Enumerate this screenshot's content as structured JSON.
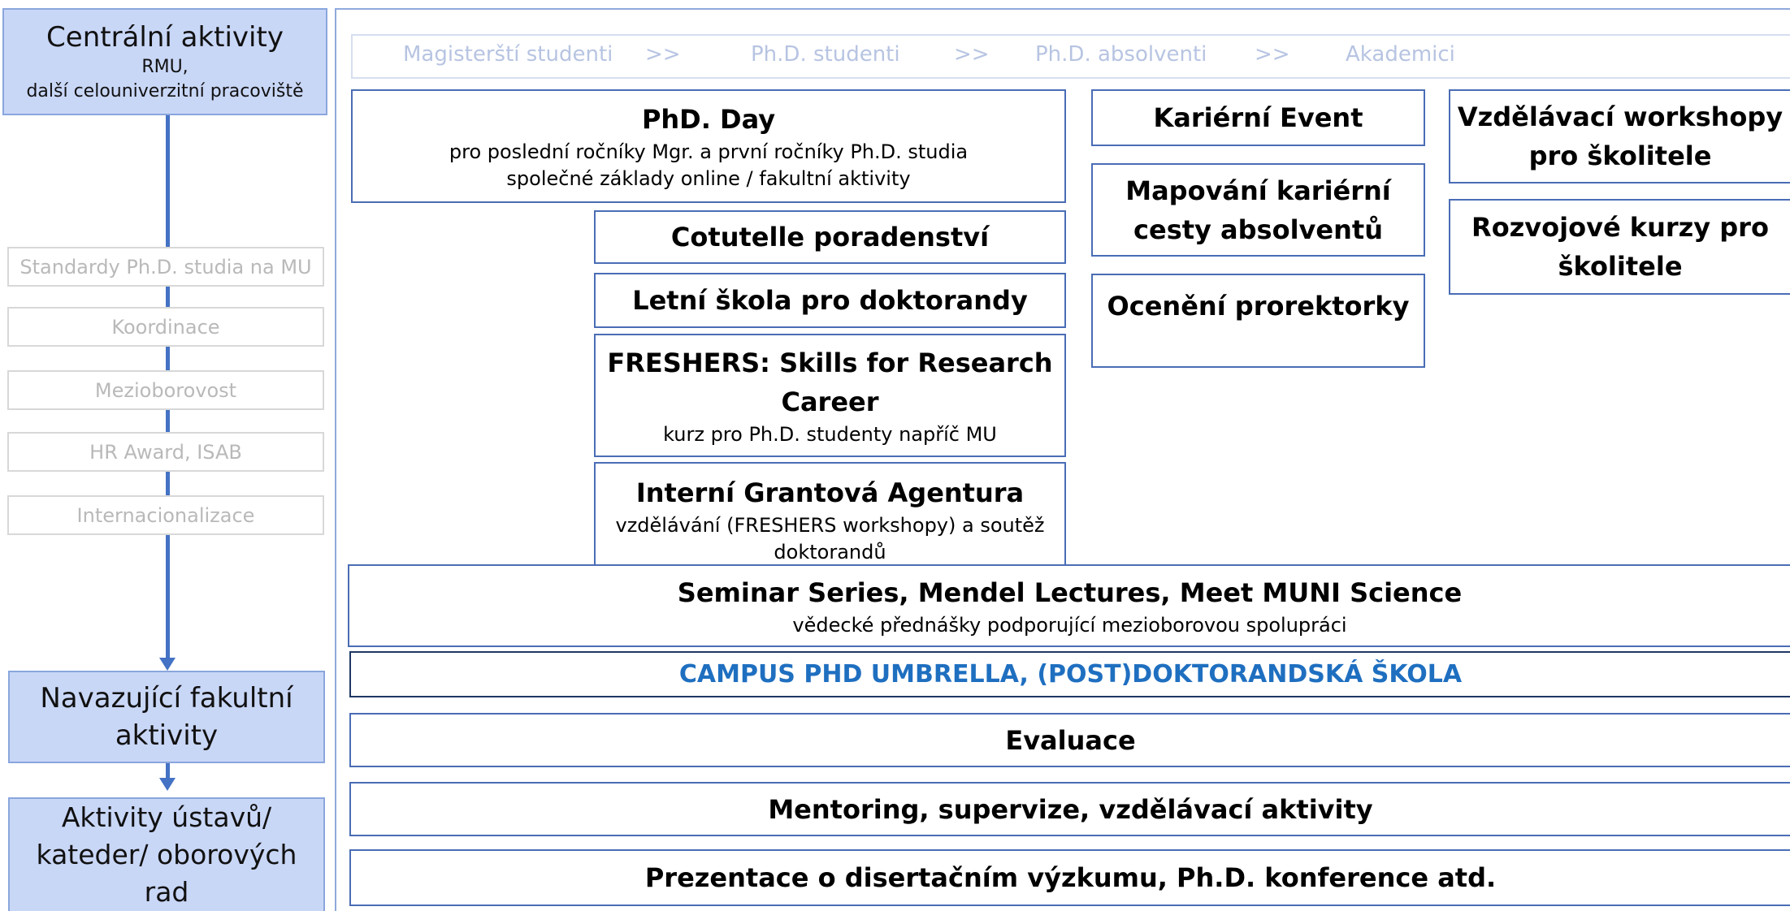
{
  "left_column": {
    "central": {
      "title": "Centrální aktivity",
      "line1": "RMU,",
      "line2": "další celouniverzitní pracoviště"
    },
    "ghost_items": [
      "Standardy Ph.D. studia na MU",
      "Koordinace",
      "Mezioborovost",
      "HR Award, ISAB",
      "Internacionalizace"
    ],
    "faculty": {
      "line1": "Navazující fakultní",
      "line2": "aktivity"
    },
    "departments": {
      "line1": "Aktivity ústavů/",
      "line2": "kateder/ oborových rad"
    }
  },
  "top_bar": {
    "items": [
      "Magisterští studenti",
      ">>",
      "Ph.D. studenti",
      ">>",
      "Ph.D. absolventi",
      ">>",
      "Akademici"
    ]
  },
  "boxes": {
    "phd_day": {
      "title": "PhD. Day",
      "sub1": "pro poslední ročníky Mgr. a první ročníky Ph.D. studia",
      "sub2": "společné základy online / fakultní aktivity"
    },
    "cotutelle": {
      "title": "Cotutelle poradenství"
    },
    "summer_school": {
      "title": "Letní škola pro doktorandy"
    },
    "freshers": {
      "title1": "FRESHERS: Skills for Research",
      "title2": "Career",
      "sub": "kurz pro Ph.D. studenty napříč MU"
    },
    "iga": {
      "title": "Interní Grantová Agentura",
      "sub1": "vzdělávání (FRESHERS workshopy) a soutěž",
      "sub2": "doktorandů"
    },
    "career_event": {
      "title": "Kariérní Event"
    },
    "mapping": {
      "line1": "Mapování kariérní",
      "line2": "cesty absolventů"
    },
    "award": {
      "title": "Ocenění prorektorky"
    },
    "workshops": {
      "line1": "Vzdělávací workshopy",
      "line2": "pro školitele"
    },
    "courses": {
      "line1": "Rozvojové kurzy pro",
      "line2": "školitele"
    },
    "seminar": {
      "title": "Seminar Series, Mendel Lectures, Meet MUNI Science",
      "sub": "vědecké přednášky podporující mezioborovou spolupráci"
    },
    "campus": {
      "title": "CAMPUS PHD UMBRELLA, (POST)DOKTORANDSKÁ ŠKOLA"
    },
    "evaluace": {
      "title": "Evaluace"
    },
    "mentoring": {
      "title": "Mentoring, supervize, vzdělávací aktivity"
    },
    "prezentace": {
      "title": "Prezentace o disertačním výzkumu, Ph.D. konference atd."
    }
  },
  "colors": {
    "column_fill": "#c9d7f7",
    "connector": "#4472c4",
    "box_border": "#4a6db5",
    "campus_text": "#1f6fc0"
  }
}
